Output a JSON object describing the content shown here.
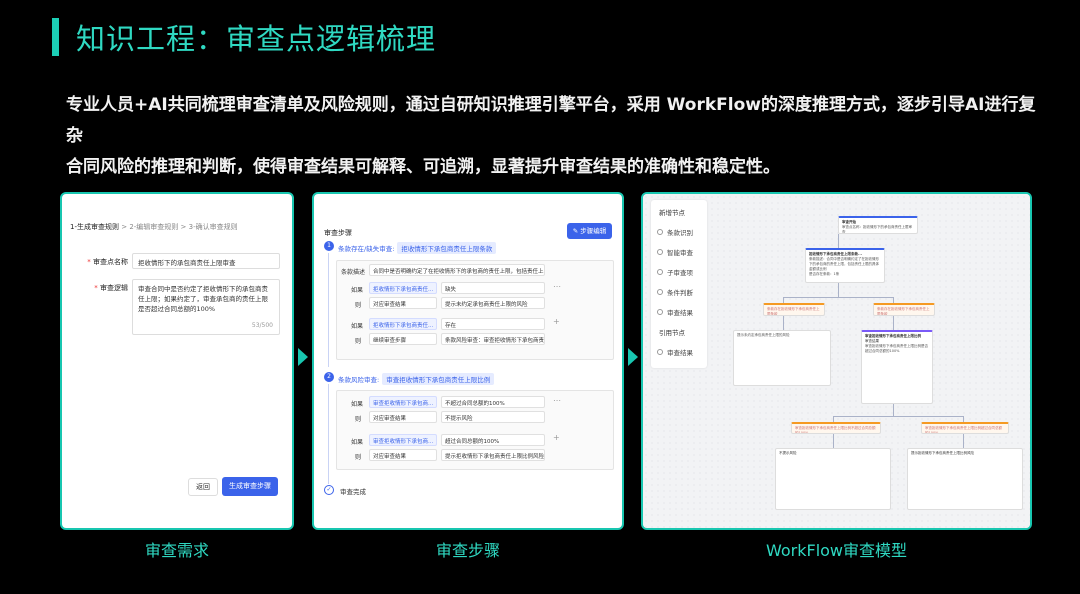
{
  "title": "知识工程：审查点逻辑梳理",
  "description_lines": [
    "专业人员+AI共同梳理审查清单及风险规则，通过自研知识推理引擎平台，采用 WorkFlow的深度推理方式，逐步引导AI进行复杂",
    "合同风险的推理和判断，使得审查结果可解释、可追溯，显著提升审查结果的准确性和稳定性。"
  ],
  "captions": [
    "审查需求",
    "审查步骤",
    "WorkFlow审查模型"
  ],
  "colors": {
    "accent": "#1ccfb6",
    "primary": "#3b63ea"
  },
  "panel1": {
    "steps": {
      "s1": "1-生成审查规则",
      "sep1": " > ",
      "s2": "2-编辑审查规则",
      "sep2": " > ",
      "s3": "3-确认审查规则"
    },
    "name_label": "审查点名称",
    "name_value": "拒收情形下的承包商责任上限审查",
    "logic_label": "审查逻辑",
    "logic_value": "审查合同中是否约定了拒收情形下的承包商责任上限；如果约定了，审查承包商的责任上限是否超过合同总额的100%",
    "counter": "53/500",
    "back_button": "返回",
    "generate_button": "生成审查步骤"
  },
  "panel2": {
    "header": "审查步骤",
    "edit_button": "步骤编辑",
    "sec1": {
      "num": "1",
      "title": "条款存在/缺失审查:",
      "tag": "拒收情形下承包商责任上限条款"
    },
    "desc_label": "条款描述",
    "desc_value": "合同中是否明确约定了在拒收情形下的承包商的责任上限，包括责任上限的",
    "r1": {
      "if": "如果",
      "cond": "拒收情形下承包商责任...",
      "val": "缺失",
      "then": "则",
      "action": "对应审查结果",
      "result": "提示未约定承包商责任上限的风险"
    },
    "r2": {
      "if": "如果",
      "cond": "拒收情形下承包商责任...",
      "val": "存在",
      "then": "则",
      "action": "继续审查步骤",
      "result": "条款风险审查：审查拒收情形下承包商责"
    },
    "sec2": {
      "num": "2",
      "title": "条款风险审查:",
      "tag": "审查拒收情形下承包商责任上限比例"
    },
    "r3": {
      "if": "如果",
      "cond": "审查拒收情形下承包商...",
      "val": "不超过合同总额的100%",
      "then": "则",
      "action": "对应审查结果",
      "result": "不提示风险"
    },
    "r4": {
      "if": "如果",
      "cond": "审查拒收情形下承包商...",
      "val": "超过合同总额的100%",
      "then": "则",
      "action": "对应审查结果",
      "result": "提示拒收情形下承包商责任上限比例风险"
    },
    "done": "审查完成"
  },
  "panel3": {
    "sidebar": {
      "add_group": "新增节点",
      "items": [
        {
          "label": "条款识别",
          "icon": "clause-icon"
        },
        {
          "label": "智能审查",
          "icon": "ai-review-icon"
        },
        {
          "label": "子审查项",
          "icon": "sub-item-icon"
        },
        {
          "label": "条件判断",
          "icon": "condition-icon"
        },
        {
          "label": "审查结果",
          "icon": "result-icon"
        }
      ],
      "ref_group": "引用节点",
      "ref_items": [
        {
          "label": "审查结果",
          "icon": "result-icon"
        }
      ]
    },
    "nodes": {
      "start_title": "审查开始",
      "start_text": "审查点名称：拒收情形下的承包商责任上限审查",
      "id_title": "拒收情形下承包商责任上限条款...",
      "id_text": "条款描述：合同中是否明确约定了在拒收情形下的承包商的责任上限，包括责任上限的具体金额或比例",
      "id_extra": "是否存在条款：1条",
      "branch_left": "条款存在拒收情形下承包商责任上限条款",
      "branch_right": "条款存在拒收情形下承包商责任上限条款",
      "left_detail": "提示未约定承包商责任上限的风险",
      "ai_title": "审查拒收情形下承包商责任上限比例",
      "ai_label": "审查结果",
      "ai_text": "审查拒收情形下承包商责任上限比例是否超过合同总额的100%",
      "bl2": "审查拒收情形下承包商责任上限比例不超过合同总额的100%",
      "br2": "审查拒收情形下承包商责任上限比例超过合同总额的100%",
      "bottom_left_title": "不提示风险",
      "bottom_right_title": "提示拒收情形下承包商责任上限比例风险"
    }
  }
}
